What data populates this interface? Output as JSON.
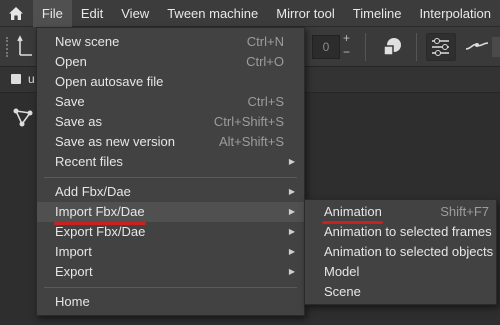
{
  "menubar": {
    "items": [
      "File",
      "Edit",
      "View",
      "Tween machine",
      "Mirror tool",
      "Timeline",
      "Interpolation"
    ]
  },
  "toolbar": {
    "frame_value": "0",
    "plus": "+",
    "minus": "−"
  },
  "tabrow": {
    "tab_label": "u"
  },
  "file_menu": {
    "items": [
      {
        "label": "New scene",
        "shortcut": "Ctrl+N"
      },
      {
        "label": "Open",
        "shortcut": "Ctrl+O"
      },
      {
        "label": "Open autosave file",
        "shortcut": ""
      },
      {
        "label": "Save",
        "shortcut": "Ctrl+S"
      },
      {
        "label": "Save as",
        "shortcut": "Ctrl+Shift+S"
      },
      {
        "label": "Save as new version",
        "shortcut": "Alt+Shift+S"
      },
      {
        "label": "Recent files",
        "shortcut": ""
      },
      {
        "label": "Add Fbx/Dae",
        "shortcut": ""
      },
      {
        "label": "Import Fbx/Dae",
        "shortcut": ""
      },
      {
        "label": "Export Fbx/Dae",
        "shortcut": ""
      },
      {
        "label": "Import",
        "shortcut": ""
      },
      {
        "label": "Export",
        "shortcut": ""
      },
      {
        "label": "Home",
        "shortcut": ""
      }
    ],
    "arrow_glyph": "▶"
  },
  "import_submenu": {
    "items": [
      {
        "label": "Animation",
        "shortcut": "Shift+F7"
      },
      {
        "label": "Animation to selected frames",
        "shortcut": ""
      },
      {
        "label": "Animation to selected objects",
        "shortcut": ""
      },
      {
        "label": "Model",
        "shortcut": ""
      },
      {
        "label": "Scene",
        "shortcut": ""
      }
    ]
  },
  "colors": {
    "menubar_bg": "#3c3c3c",
    "menu_bg": "#424242",
    "highlight_bg": "#505050",
    "annotation_underline": "#cc1f1f"
  }
}
